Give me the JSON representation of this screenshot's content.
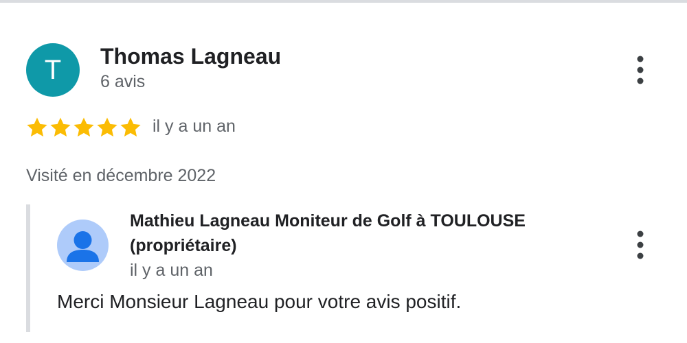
{
  "review": {
    "avatar_initial": "T",
    "avatar_color": "#0f99a8",
    "reviewer_name": "Thomas Lagneau",
    "review_count": "6 avis",
    "rating": 5,
    "rating_max": 5,
    "star_color": "#fbbc04",
    "time": "il y a un an",
    "visited": "Visité en décembre 2022",
    "menu_icon": "more-vert-icon"
  },
  "reply": {
    "owner_name": "Mathieu Lagneau Moniteur de Golf à TOULOUSE (propriétaire)",
    "avatar_icon": "default-person-avatar",
    "avatar_color": "#aecbfa",
    "time": "il y a un an",
    "text": "Merci Monsieur Lagneau pour votre avis positif.",
    "menu_icon": "more-vert-icon"
  }
}
